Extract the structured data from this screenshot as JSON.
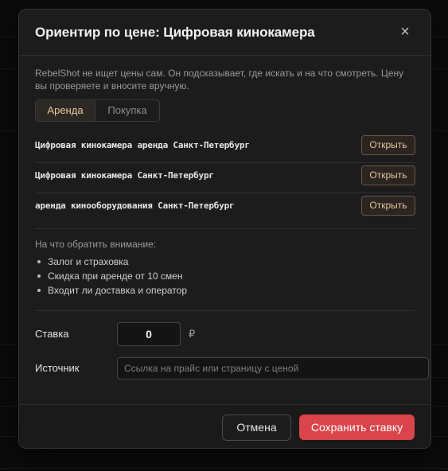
{
  "dialog": {
    "title": "Ориентир по цене: Цифровая кинокамера",
    "close_icon": "close-icon",
    "close_glyph": "×",
    "notice": "RebelShot не ищет цены сам. Он подсказывает, где искать и на что смотреть. Цену вы проверяете и вносите вручную."
  },
  "tabs": {
    "selected": "Аренда",
    "items": [
      {
        "label": "Аренда"
      },
      {
        "label": "Покупка"
      }
    ]
  },
  "queries": [
    {
      "text": "Цифровая кинокамера аренда Санкт-Петербург",
      "button": "Открыть"
    },
    {
      "text": "Цифровая кинокамера Санкт-Петербург",
      "button": "Открыть"
    },
    {
      "text": "аренда кинооборудования Санкт-Петербург",
      "button": "Открыть"
    }
  ],
  "tips": {
    "title": "На что обратить внимание:",
    "items": [
      "Залог и страховка",
      "Скидка при аренде от 10 смен",
      "Входит ли доставка и оператор"
    ]
  },
  "form": {
    "rate_label": "Ставка",
    "rate_value": "0",
    "currency": "₽",
    "source_label": "Источник",
    "source_placeholder": "Ссылка на прайс или страницу с ценой"
  },
  "footer": {
    "cancel_label": "Отмена",
    "save_label": "Сохранить ставку"
  },
  "colors": {
    "accent": "#d9454b",
    "tab_active_text": "#e9c9a0",
    "open_button_border": "#6b5642"
  }
}
